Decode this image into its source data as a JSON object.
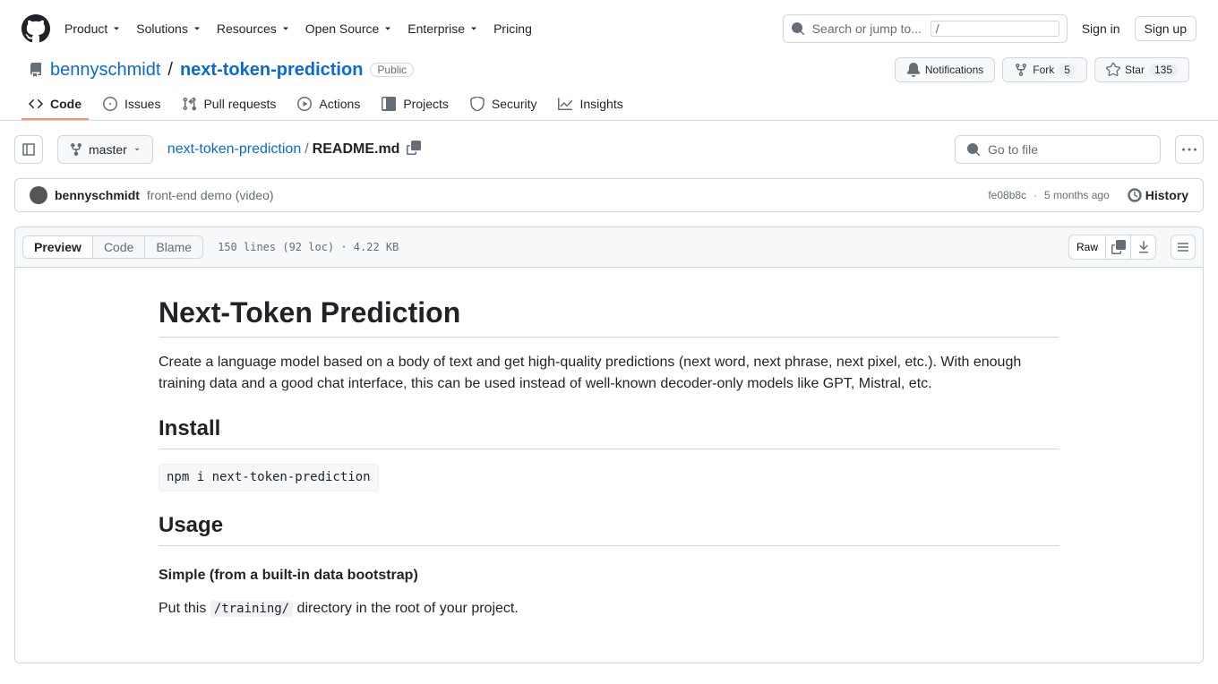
{
  "header": {
    "nav": [
      "Product",
      "Solutions",
      "Resources",
      "Open Source",
      "Enterprise",
      "Pricing"
    ],
    "nav_has_dropdown": [
      true,
      true,
      true,
      true,
      true,
      false
    ],
    "search_placeholder": "Search or jump to...",
    "search_kbd": "/",
    "signin": "Sign in",
    "signup": "Sign up"
  },
  "repo": {
    "owner": "bennyschmidt",
    "name": "next-token-prediction",
    "visibility": "Public",
    "actions": {
      "notifications": "Notifications",
      "fork": "Fork",
      "fork_count": "5",
      "star": "Star",
      "star_count": "135"
    }
  },
  "tabs": [
    "Code",
    "Issues",
    "Pull requests",
    "Actions",
    "Projects",
    "Security",
    "Insights"
  ],
  "location": {
    "branch": "master",
    "root_link": "next-token-prediction",
    "file": "README.md",
    "gotofile": "Go to file"
  },
  "commit": {
    "author": "bennyschmidt",
    "message": "front-end demo (video)",
    "sha": "fe08b8c",
    "dot": "·",
    "time": "5 months ago",
    "history": "History"
  },
  "file": {
    "views": [
      "Preview",
      "Code",
      "Blame"
    ],
    "stats": "150 lines (92 loc) · 4.22 KB",
    "raw": "Raw"
  },
  "readme": {
    "h1": "Next-Token Prediction",
    "intro": "Create a language model based on a body of text and get high-quality predictions (next word, next phrase, next pixel, etc.). With enough training data and a good chat interface, this can be used instead of well-known decoder-only models like GPT, Mistral, etc.",
    "h2_install": "Install",
    "install_cmd": "npm i next-token-prediction",
    "h2_usage": "Usage",
    "h3_simple": "Simple (from a built-in data bootstrap)",
    "usage_p1a": "Put this ",
    "usage_code": "/training/",
    "usage_p1b": " directory in the root of your project."
  }
}
